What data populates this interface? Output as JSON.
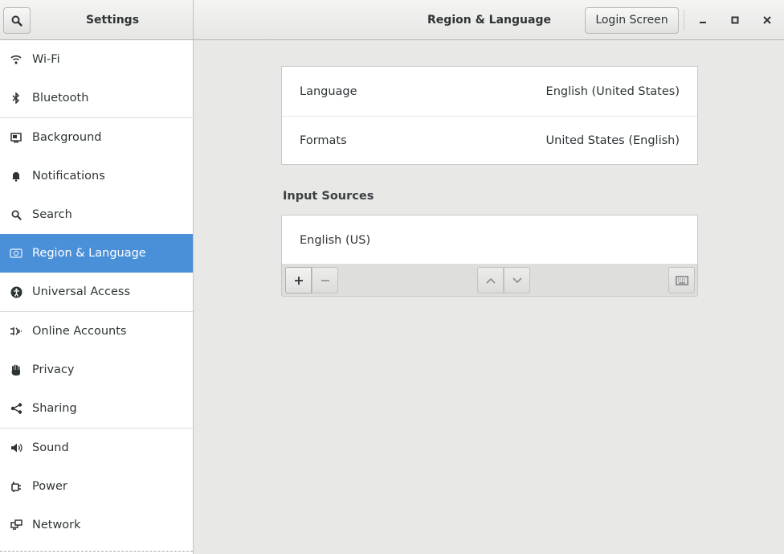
{
  "header": {
    "sidebar_title": "Settings",
    "title": "Region & Language",
    "login_button": "Login Screen"
  },
  "sidebar": {
    "items": [
      {
        "label": "Wi-Fi",
        "icon": "wifi-icon"
      },
      {
        "label": "Bluetooth",
        "icon": "bluetooth-icon"
      },
      {
        "label": "Background",
        "icon": "background-icon"
      },
      {
        "label": "Notifications",
        "icon": "bell-icon"
      },
      {
        "label": "Search",
        "icon": "search-icon"
      },
      {
        "label": "Region & Language",
        "icon": "region-flag-icon",
        "selected": true
      },
      {
        "label": "Universal Access",
        "icon": "accessibility-icon"
      },
      {
        "label": "Online Accounts",
        "icon": "online-accounts-icon"
      },
      {
        "label": "Privacy",
        "icon": "hand-icon"
      },
      {
        "label": "Sharing",
        "icon": "share-icon"
      },
      {
        "label": "Sound",
        "icon": "speaker-icon"
      },
      {
        "label": "Power",
        "icon": "power-plug-icon"
      },
      {
        "label": "Network",
        "icon": "network-icon"
      }
    ]
  },
  "main": {
    "language": {
      "label": "Language",
      "value": "English (United States)"
    },
    "formats": {
      "label": "Formats",
      "value": "United States (English)"
    },
    "input_sources": {
      "title": "Input Sources",
      "items": [
        "English (US)"
      ]
    }
  },
  "colors": {
    "accent": "#4a90d9",
    "background": "#e8e8e7",
    "sidebar": "#ffffff"
  }
}
